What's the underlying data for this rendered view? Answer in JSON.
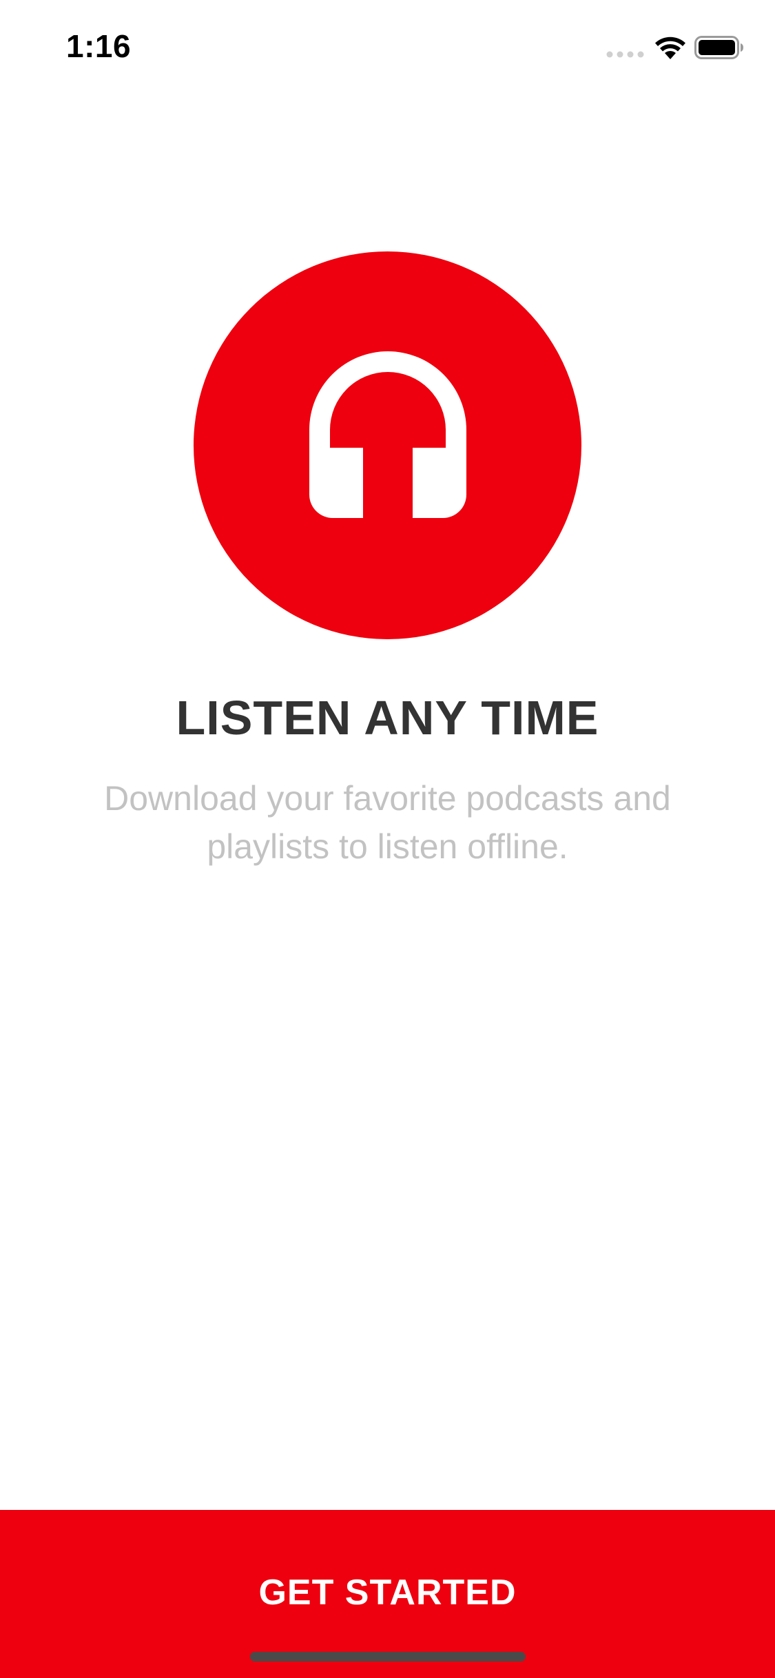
{
  "status_bar": {
    "time": "1:16",
    "signal_icon": "signal-dots-icon",
    "wifi_icon": "wifi-icon",
    "battery_icon": "battery-icon"
  },
  "hero": {
    "icon": "headphones-icon",
    "background_color": "#ee000e",
    "icon_color": "#ffffff"
  },
  "content": {
    "title": "LISTEN ANY TIME",
    "description": "Download your favorite podcasts and playlists to listen offline."
  },
  "cta": {
    "label": "GET STARTED",
    "background_color": "#ee000e"
  },
  "colors": {
    "accent": "#ee000e",
    "title_text": "#333333",
    "description_text": "#c2c2c2"
  }
}
